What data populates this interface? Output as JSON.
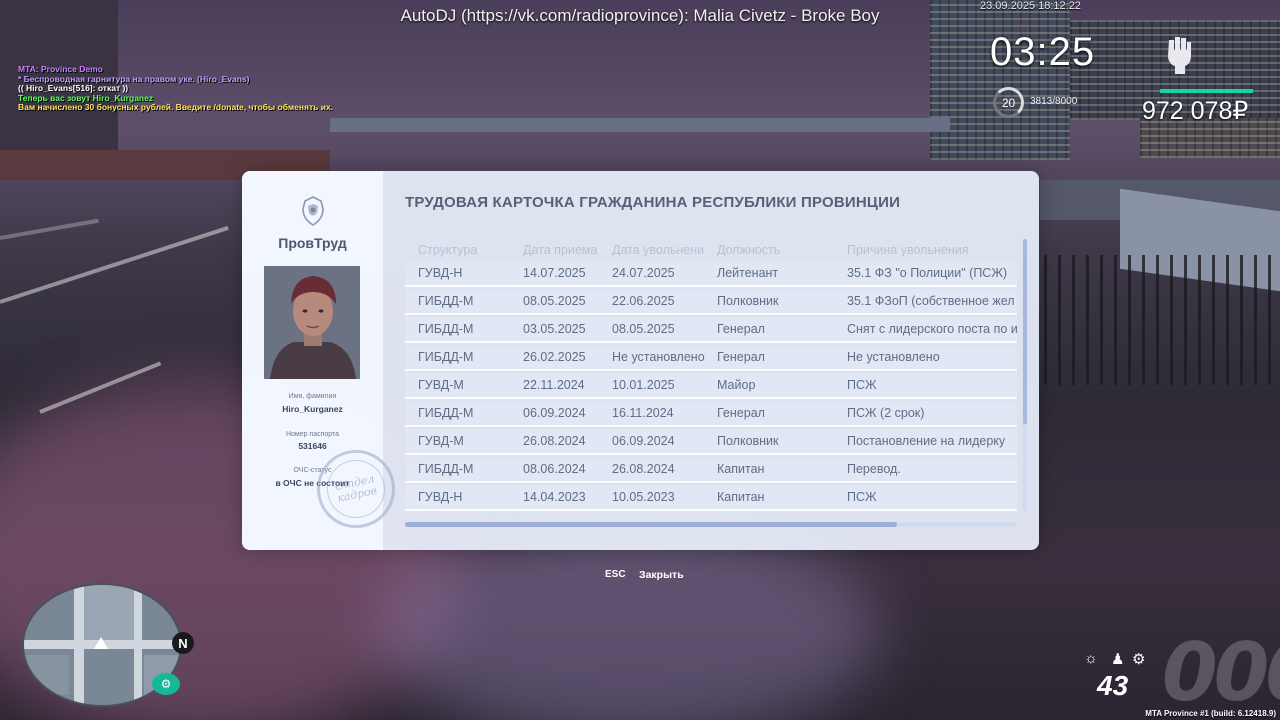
{
  "hud": {
    "radio": "AutoDJ (https://vk.com/radioprovince): Malia Civetz - Broke Boy",
    "datetime": "23.09.2025 18:12:22",
    "timer_mark": "↑↑",
    "timer": "03:25",
    "level": "20",
    "xp": "3813/8000",
    "money": "972 078₽",
    "build": "MTA Province #1 (build: 6.12418.9)"
  },
  "chat": [
    {
      "text": "MTA: Province Demo",
      "color": "#c880ff"
    },
    {
      "text": " * Беспроводная гарнитура на правом уке. (Hiro_Evans)",
      "color": "#c59cff"
    },
    {
      "text": "(( Hiro_Evans[516]: откат ))",
      "color": "#ffffff"
    },
    {
      "text": "Теперь вас зовут Hiro_Kurganez",
      "color": "#5dff5d"
    },
    {
      "text": "Вам начислено 30 бонусных рублей. Введите /donate, чтобы обменять их.",
      "color": "#ffe45c"
    }
  ],
  "card": {
    "brand": "ПровТруд",
    "title": "ТРУДОВАЯ КАРТОЧКА ГРАЖДАНИНА РЕСПУБЛИКИ ПРОВИНЦИИ",
    "name_label": "Имя, фамилия",
    "name_value": "Hiro_Kurganez",
    "passport_label": "Номер паспорта",
    "passport_value": "531646",
    "status_label": "ОЧС-статус",
    "status_value": "в ОЧС не состоит",
    "stamp_text": "Отдел кадров",
    "columns": [
      "Структура",
      "Дата приема",
      "Дата увольнени",
      "Должность",
      "Причина увольнения"
    ],
    "rows": [
      [
        "ГУВД-Н",
        "14.07.2025",
        "24.07.2025",
        "Лейтенант",
        "35.1 ФЗ \"о Полиции\" (ПСЖ)"
      ],
      [
        "ГИБДД-М",
        "08.05.2025",
        "22.06.2025",
        "Полковник",
        "35.1 ФЗоП (собственное жел"
      ],
      [
        "ГИБДД-М",
        "03.05.2025",
        "08.05.2025",
        "Генерал",
        "Снят с лидерского поста по и"
      ],
      [
        "ГИБДД-М",
        "26.02.2025",
        "Не установлено",
        "Генерал",
        "Не установлено"
      ],
      [
        "ГУВД-М",
        "22.11.2024",
        "10.01.2025",
        "Майор",
        "ПСЖ"
      ],
      [
        "ГИБДД-М",
        "06.09.2024",
        "16.11.2024",
        "Генерал",
        "ПСЖ (2 срок)"
      ],
      [
        "ГУВД-М",
        "26.08.2024",
        "06.09.2024",
        "Полковник",
        "Постановление на лидерку"
      ],
      [
        "ГИБДД-М",
        "08.06.2024",
        "26.08.2024",
        "Капитан",
        "Перевод."
      ],
      [
        "ГУВД-Н",
        "14.04.2023",
        "10.05.2023",
        "Капитан",
        "ПСЖ"
      ]
    ]
  },
  "close": {
    "key": "ESC",
    "label": "Закрыть"
  },
  "minimap": {
    "north": "N"
  },
  "vehicle": {
    "fuel": "43",
    "speed": "000"
  }
}
